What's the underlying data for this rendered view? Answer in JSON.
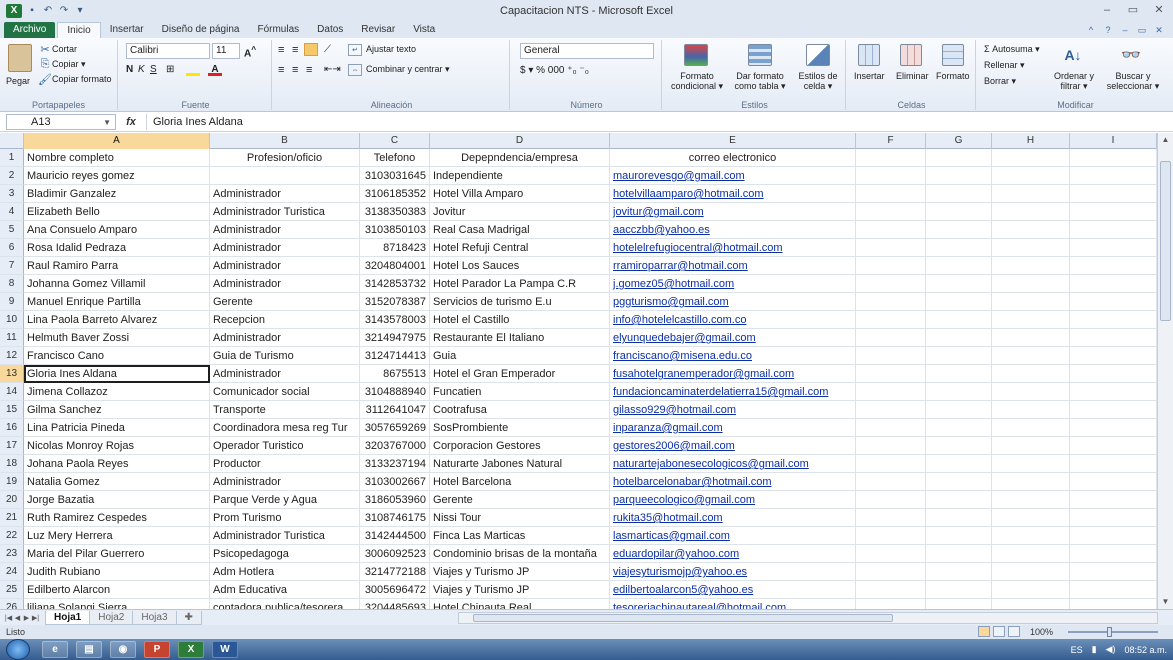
{
  "window": {
    "title": "Capacitacion NTS - Microsoft Excel",
    "controls": [
      "–",
      "▭",
      "✕"
    ]
  },
  "ribbon_tabs": [
    "Archivo",
    "Inicio",
    "Insertar",
    "Diseño de página",
    "Fórmulas",
    "Datos",
    "Revisar",
    "Vista"
  ],
  "ribbon": {
    "clipboard": {
      "paste": "Pegar",
      "cut": "Cortar",
      "copy": "Copiar ▾",
      "format_painter": "Copiar formato",
      "label": "Portapapeles"
    },
    "font": {
      "name": "Calibri",
      "size": "11",
      "label": "Fuente"
    },
    "alignment": {
      "wrap": "Ajustar texto",
      "merge": "Combinar y centrar ▾",
      "label": "Alineación"
    },
    "number": {
      "format": "General",
      "label": "Número",
      "symbols": "$ ▾ % 000 ⁺₀ ⁻₀"
    },
    "styles": {
      "conditional": "Formato condicional ▾",
      "table": "Dar formato como tabla ▾",
      "cell_styles": "Estilos de celda ▾",
      "label": "Estilos"
    },
    "cells": {
      "insert": "Insertar",
      "delete": "Eliminar",
      "format": "Formato",
      "label": "Celdas"
    },
    "editing": {
      "autosum": "Σ Autosuma ▾",
      "fill": "Rellenar ▾",
      "clear": "Borrar ▾",
      "sort": "Ordenar y filtrar ▾",
      "find": "Buscar y seleccionar ▾",
      "label": "Modificar"
    }
  },
  "formula_bar": {
    "name_box": "A13",
    "fx": "fx",
    "value": "Gloria Ines Aldana"
  },
  "columns": [
    "A",
    "B",
    "C",
    "D",
    "E",
    "F",
    "G",
    "H",
    "I"
  ],
  "selected_column": "A",
  "rows": [
    {
      "n": "1",
      "a": "Nombre completo",
      "b": "Profesion/oficio",
      "c": "Telefono",
      "d": "Depepndencia/empresa",
      "e": "correo electronico"
    },
    {
      "n": "2",
      "a": "Mauricio reyes gomez",
      "b": "",
      "c": "3103031645",
      "d": "Independiente",
      "e": "maurorevesgo@gmail.com"
    },
    {
      "n": "3",
      "a": "Bladimir Ganzalez",
      "b": "Administrador",
      "c": "3106185352",
      "d": "Hotel Villa Amparo",
      "e": "hotelvillaamparo@hotmail.com"
    },
    {
      "n": "4",
      "a": "Elizabeth Bello",
      "b": "Administrador Turistica",
      "c": "3138350383",
      "d": "Jovitur",
      "e": "jovitur@gmail.com"
    },
    {
      "n": "5",
      "a": "Ana Consuelo Amparo",
      "b": "Administrador",
      "c": "3103850103",
      "d": "Real Casa Madrigal",
      "e": "aacczbb@yahoo.es"
    },
    {
      "n": "6",
      "a": "Rosa Idalid Pedraza",
      "b": "Administrador",
      "c": "8718423",
      "d": "Hotel Refuji Central",
      "e": "hotelelrefugiocentral@hotmail.com"
    },
    {
      "n": "7",
      "a": "Raul Ramiro Parra",
      "b": "Administrador",
      "c": "3204804001",
      "d": "Hotel Los Sauces",
      "e": "rramiroparrar@hotmail.com"
    },
    {
      "n": "8",
      "a": "Johanna Gomez Villamil",
      "b": "Administrador",
      "c": "3142853732",
      "d": "Hotel Parador La Pampa C.R",
      "e": "j.gomez05@hotmail.com"
    },
    {
      "n": "9",
      "a": "Manuel Enrique Partilla",
      "b": "Gerente",
      "c": "3152078387",
      "d": "Servicios de turismo E.u",
      "e": "pggturismo@gmail.com"
    },
    {
      "n": "10",
      "a": "Lina Paola Barreto Alvarez",
      "b": "Recepcion",
      "c": "3143578003",
      "d": "Hotel el Castillo",
      "e": "info@hotelelcastillo.com.co"
    },
    {
      "n": "11",
      "a": "Helmuth Baver Zossi",
      "b": "Administrador",
      "c": "3214947975",
      "d": "Restaurante El Italiano",
      "e": "elyunquedebajer@gmail.com"
    },
    {
      "n": "12",
      "a": "Francisco Cano",
      "b": "Guia de Turismo",
      "c": "3124714413",
      "d": "Guia",
      "e": "franciscano@misena.edu.co"
    },
    {
      "n": "13",
      "a": "Gloria Ines Aldana",
      "b": "Administrador",
      "c": "8675513",
      "d": "Hotel el Gran Emperador",
      "e": "fusahotelgranemperador@gmail.com"
    },
    {
      "n": "14",
      "a": "Jimena Collazoz",
      "b": "Comunicador social",
      "c": "3104888940",
      "d": "Funcatien",
      "e": "fundacioncaminaterdelatierra15@gmail.com"
    },
    {
      "n": "15",
      "a": "Gilma Sanchez",
      "b": "Transporte",
      "c": "3112641047",
      "d": "Cootrafusa",
      "e": "gilasso929@hotmail.com"
    },
    {
      "n": "16",
      "a": "Lina Patricia Pineda",
      "b": "Coordinadora mesa reg Tur",
      "c": "3057659269",
      "d": "SosPrombiente",
      "e": "inparanza@gmail.com"
    },
    {
      "n": "17",
      "a": "Nicolas Monroy Rojas",
      "b": "Operador Turistico",
      "c": "3203767000",
      "d": "Corporacion Gestores",
      "e": "gestores2006@mail.com"
    },
    {
      "n": "18",
      "a": "Johana Paola Reyes",
      "b": "Productor",
      "c": "3133237194",
      "d": "Naturarte Jabones Natural",
      "e": "naturartejabonesecologicos@gmail.com"
    },
    {
      "n": "19",
      "a": "Natalia Gomez",
      "b": "Administrador",
      "c": "3103002667",
      "d": "Hotel Barcelona",
      "e": "hotelbarcelonabar@hotmail.com"
    },
    {
      "n": "20",
      "a": "Jorge Bazatia",
      "b": "Parque Verde y Agua",
      "c": "3186053960",
      "d": "Gerente",
      "e": "parqueecologico@gmail.com"
    },
    {
      "n": "21",
      "a": "Ruth Ramirez Cespedes",
      "b": "Prom Turismo",
      "c": "3108746175",
      "d": "Nissi Tour",
      "e": "rukita35@hotmail.com"
    },
    {
      "n": "22",
      "a": "Luz Mery Herrera",
      "b": "Administrador Turistica",
      "c": "3142444500",
      "d": "Finca Las Marticas",
      "e": "lasmarticas@gmail.com"
    },
    {
      "n": "23",
      "a": "Maria del Pilar Guerrero",
      "b": "Psicopedagoga",
      "c": "3006092523",
      "d": "Condominio brisas de la montaña",
      "e": "eduardopilar@yahoo.com"
    },
    {
      "n": "24",
      "a": "Judith Rubiano",
      "b": "Adm Hotlera",
      "c": "3214772188",
      "d": "Viajes y Turismo JP",
      "e": "viajesyturismojp@yahoo.es"
    },
    {
      "n": "25",
      "a": "Edilberto Alarcon",
      "b": "Adm Educativa",
      "c": "3005696472",
      "d": "Viajes y Turismo JP",
      "e": "edilbertoalarcon5@yahoo.es"
    },
    {
      "n": "26",
      "a": "liliana Solangi Sierra",
      "b": "contadora publica/tesorera",
      "c": "3204485693",
      "d": "Hotel Chinauta Real",
      "e": "tesoreriachinautareal@hotmail.com"
    }
  ],
  "active_row": "13",
  "sheets": [
    "Hoja1",
    "Hoja2",
    "Hoja3"
  ],
  "active_sheet": "Hoja1",
  "status": {
    "ready": "Listo",
    "zoom": "100%"
  },
  "taskbar": {
    "clock": "08:52 a.m.",
    "lang": "ES",
    "apps": [
      "IE",
      "folder",
      "chrome",
      "P",
      "X",
      "W"
    ]
  }
}
